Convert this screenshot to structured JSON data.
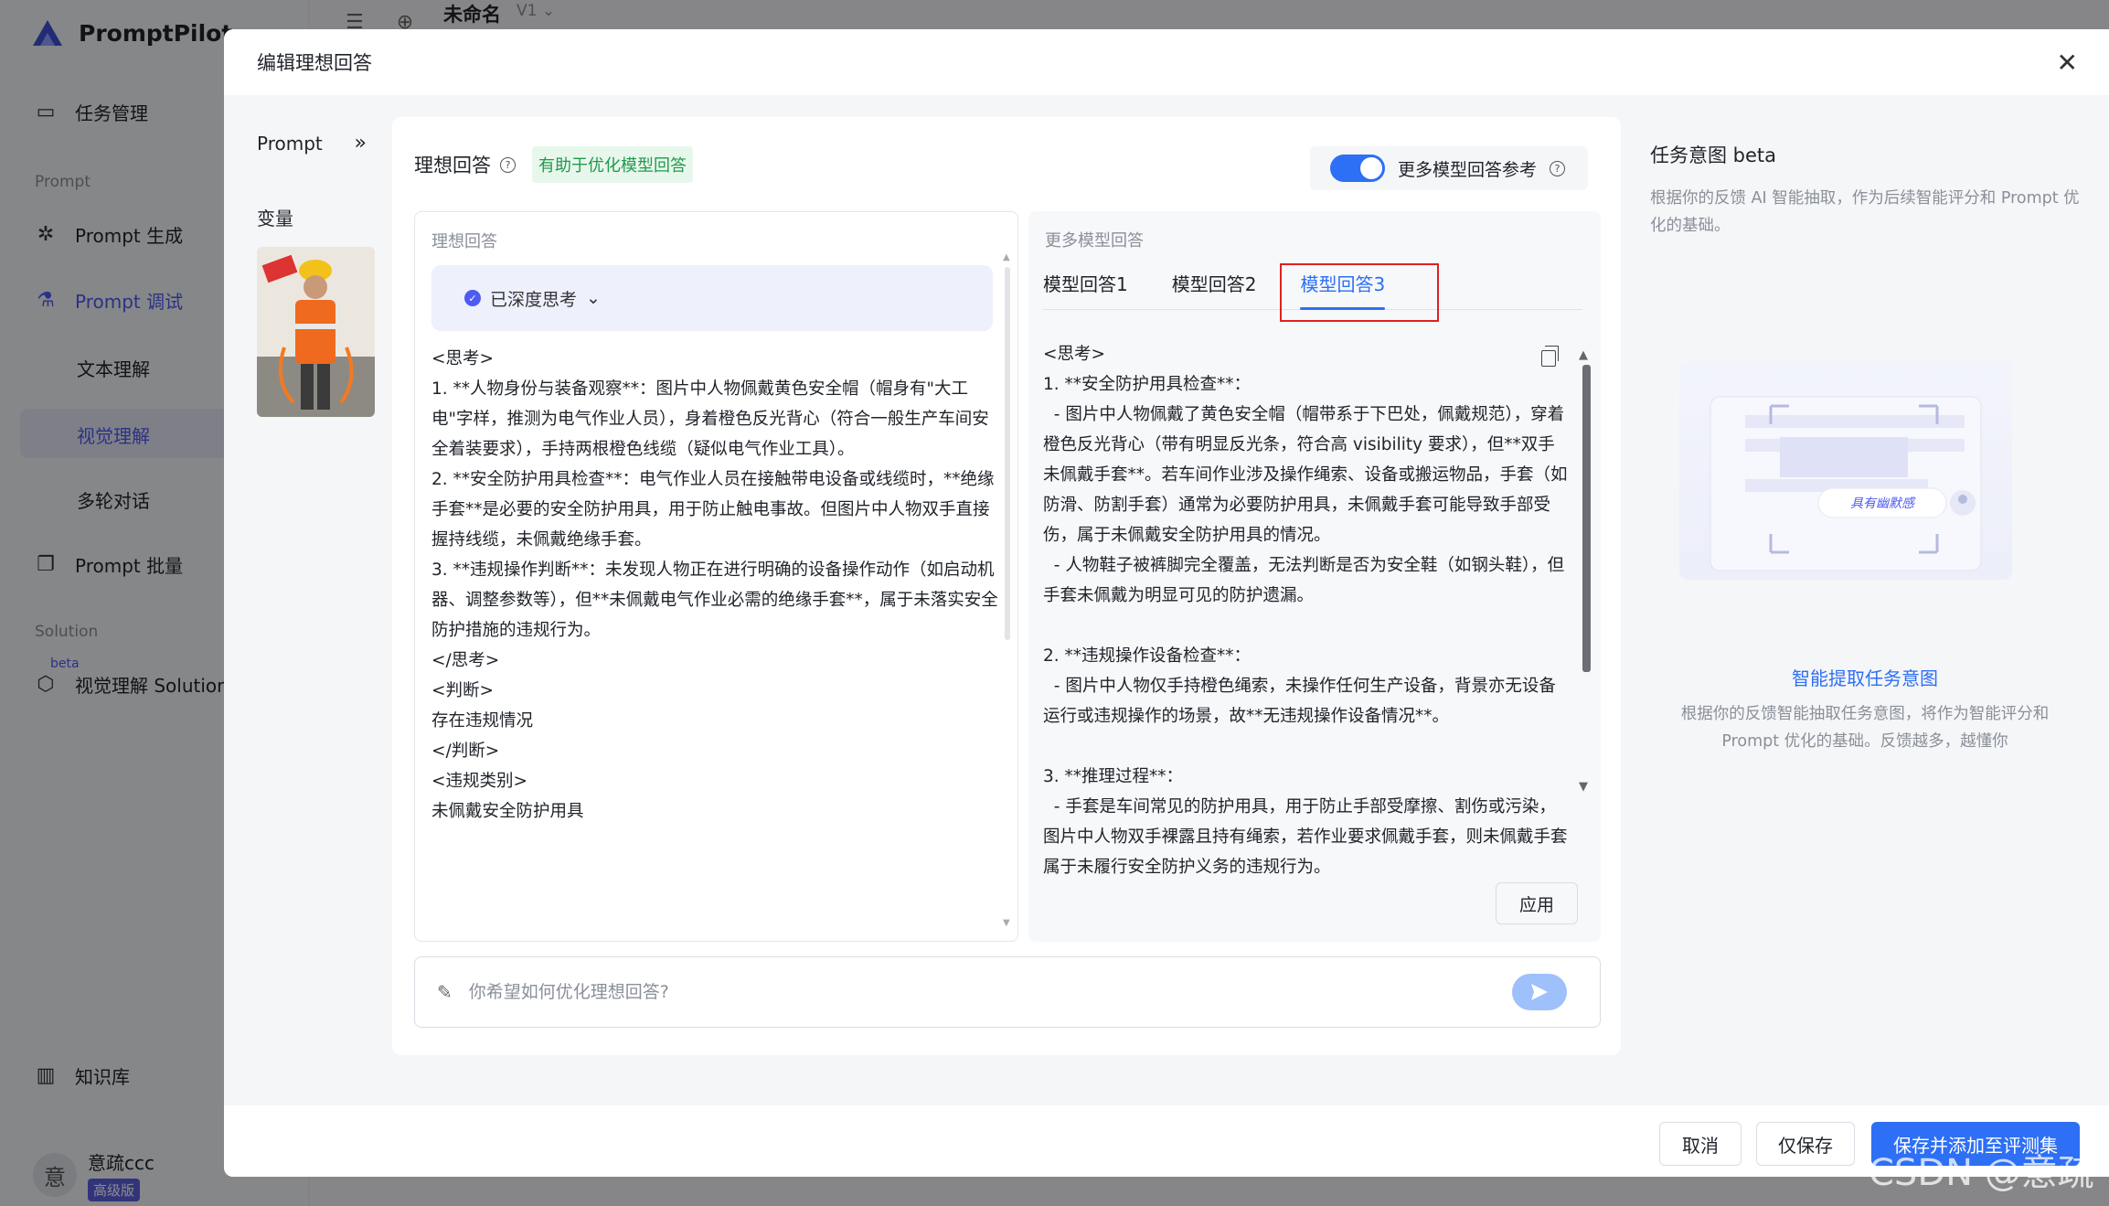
{
  "app": {
    "logo_text": "PromptPilot",
    "nav": {
      "task_mgmt": "任务管理",
      "section_prompt": "Prompt",
      "prompt_gen": "Prompt 生成",
      "prompt_debug": "Prompt 调试",
      "text_understanding": "文本理解",
      "visual_understanding": "视觉理解",
      "multi_turn": "多轮对话",
      "prompt_batch": "Prompt 批量",
      "section_solution": "Solution",
      "beta_tag": "beta",
      "visual_solution": "视觉理解 Solution",
      "knowledge_base": "知识库"
    },
    "user": {
      "avatar_char": "意",
      "name": "意疏ccc",
      "badge": "高级版"
    },
    "topbar": {
      "title": "未命名",
      "version": "V1"
    }
  },
  "modal": {
    "title": "编辑理想回答",
    "left": {
      "prompt_label": "Prompt",
      "variables_label": "变量"
    },
    "card": {
      "title": "理想回答",
      "tag": "有助于优化模型回答",
      "toggle_label": "更多模型回答参考",
      "ideal_panel": {
        "label": "理想回答",
        "think_label": "已深度思考",
        "content": "<思考>\n1. **人物身份与装备观察**：图片中人物佩戴黄色安全帽（帽身有\"大工电\"字样，推测为电气作业人员），身着橙色反光背心（符合一般生产车间安全着装要求），手持两根橙色线缆（疑似电气作业工具）。\n2. **安全防护用具检查**：电气作业人员在接触带电设备或线缆时，**绝缘手套**是必要的安全防护用具，用于防止触电事故。但图片中人物双手直接握持线缆，未佩戴绝缘手套。\n3. **违规操作判断**：未发现人物正在进行明确的设备操作动作（如启动机器、调整参数等），但**未佩戴电气作业必需的绝缘手套**，属于未落实安全防护措施的违规行为。\n</思考>\n<判断>\n存在违规情况\n</判断>\n<违规类别>\n未佩戴安全防护用具"
      },
      "more_panel": {
        "label": "更多模型回答",
        "tabs": [
          "模型回答1",
          "模型回答2",
          "模型回答3"
        ],
        "active_tab": 2,
        "content": "<思考>\n1. **安全防护用具检查**：\n  - 图片中人物佩戴了黄色安全帽（帽带系于下巴处，佩戴规范），穿着橙色反光背心（带有明显反光条，符合高 visibility 要求），但**双手未佩戴手套**。若车间作业涉及操作绳索、设备或搬运物品，手套（如防滑、防割手套）通常为必要防护用具，未佩戴手套可能导致手部受伤，属于未佩戴安全防护用具的情况。\n  - 人物鞋子被裤脚完全覆盖，无法判断是否为安全鞋（如钢头鞋），但手套未佩戴为明显可见的防护遗漏。\n\n2. **违规操作设备检查**：\n  - 图片中人物仅手持橙色绳索，未操作任何生产设备，背景亦无设备运行或违规操作的场景，故**无违规操作设备情况**。\n\n3. **推理过程**：\n  - 手套是车间常见的防护用具，用于防止手部受摩擦、割伤或污染，图片中人物双手裸露且持有绳索，若作业要求佩戴手套，则未佩戴手套属于未履行安全防护义务的违规行为。",
        "apply_label": "应用"
      },
      "input_placeholder": "你希望如何优化理想回答?"
    },
    "right": {
      "title": "任务意图 beta",
      "desc": "根据你的反馈 AI 智能抽取，作为后续智能评分和 Prompt 优化的基础。",
      "illus_chip": "具有幽默感",
      "link": "智能提取任务意图",
      "desc2": "根据你的反馈智能抽取任务意图，将作为智能评分和 Prompt 优化的基础。反馈越多，越懂你"
    },
    "footer": {
      "cancel": "取消",
      "save_only": "仅保存",
      "save_add": "保存并添加至评测集"
    }
  },
  "watermark": "CSDN @意疏",
  "colors": {
    "primary": "#2d6ff5",
    "tag_green": "#1f9a4d",
    "highlight_red": "#e02020"
  }
}
